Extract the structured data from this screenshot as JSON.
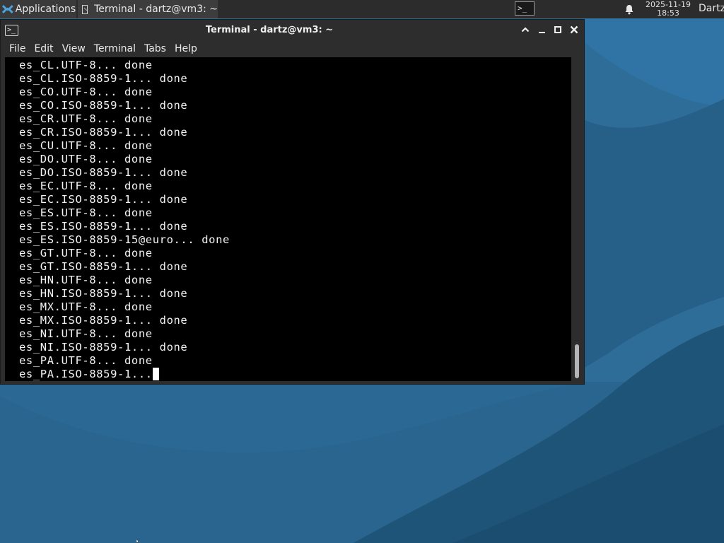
{
  "panel": {
    "applications_label": "Applications",
    "task_title": "Terminal - dartz@vm3: ~",
    "tray_terminal_glyph": ">_",
    "clock_date": "2025-11-19",
    "clock_time": "18:53",
    "user": "Dartz"
  },
  "window": {
    "title": "Terminal - dartz@vm3: ~",
    "icon_glyph": ">_",
    "menu": [
      "File",
      "Edit",
      "View",
      "Terminal",
      "Tabs",
      "Help"
    ]
  },
  "terminal": {
    "lines": [
      "es_CL.UTF-8... done",
      "es_CL.ISO-8859-1... done",
      "es_CO.UTF-8... done",
      "es_CO.ISO-8859-1... done",
      "es_CR.UTF-8... done",
      "es_CR.ISO-8859-1... done",
      "es_CU.UTF-8... done",
      "es_DO.UTF-8... done",
      "es_DO.ISO-8859-1... done",
      "es_EC.UTF-8... done",
      "es_EC.ISO-8859-1... done",
      "es_ES.UTF-8... done",
      "es_ES.ISO-8859-1... done",
      "es_ES.ISO-8859-15@euro... done",
      "es_GT.UTF-8... done",
      "es_GT.ISO-8859-1... done",
      "es_HN.UTF-8... done",
      "es_HN.ISO-8859-1... done",
      "es_MX.UTF-8... done",
      "es_MX.ISO-8859-1... done",
      "es_NI.UTF-8... done",
      "es_NI.ISO-8859-1... done",
      "es_PA.UTF-8... done",
      "es_PA.ISO-8859-1..."
    ]
  },
  "colors": {
    "desktop": "#245a82",
    "panel": "#2c2c2c",
    "window": "#2d2d2d",
    "terminal_bg": "#000000",
    "terminal_fg": "#f2f2f2"
  }
}
